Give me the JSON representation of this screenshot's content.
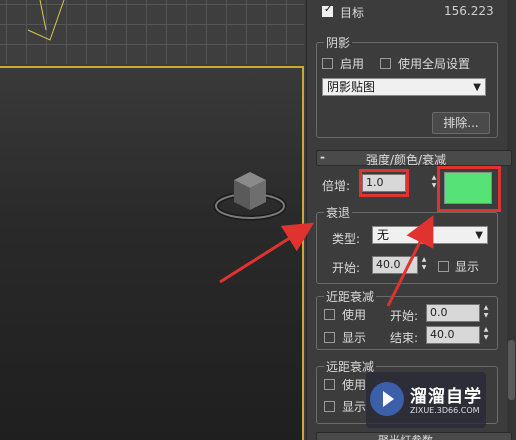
{
  "target_row": {
    "label": "目标",
    "value": "156.223"
  },
  "shadow_group": {
    "title": "阴影",
    "enable_label": "启用",
    "global_label": "使用全局设置",
    "shadow_type": "阴影贴图",
    "exclude_button": "排除..."
  },
  "intensity_rollout": {
    "collapse_symbol": "-",
    "title": "强度/颜色/衰减",
    "multiplier_label": "倍增:",
    "multiplier_value": "1.0",
    "color": "#56e277"
  },
  "decay_group": {
    "title": "衰退",
    "type_label": "类型:",
    "type_value": "无",
    "start_label": "开始:",
    "start_value": "40.0",
    "show_label": "显示"
  },
  "near_atten": {
    "title": "近距衰减",
    "use_label": "使用",
    "start_label": "开始:",
    "start_value": "0.0",
    "show_label": "显示",
    "end_label": "结束:",
    "end_value": "40.0"
  },
  "far_atten": {
    "title": "远距衰减",
    "use_label": "使用",
    "show_label": "显示"
  },
  "bottom_rollout": {
    "title": "聚光灯参数"
  },
  "watermark": {
    "title": "溜溜自学",
    "url": "ZIXUE.3D66.COM"
  },
  "colors": {
    "annotation_red": "#e0322e",
    "viewport_border": "#c9a83a"
  }
}
